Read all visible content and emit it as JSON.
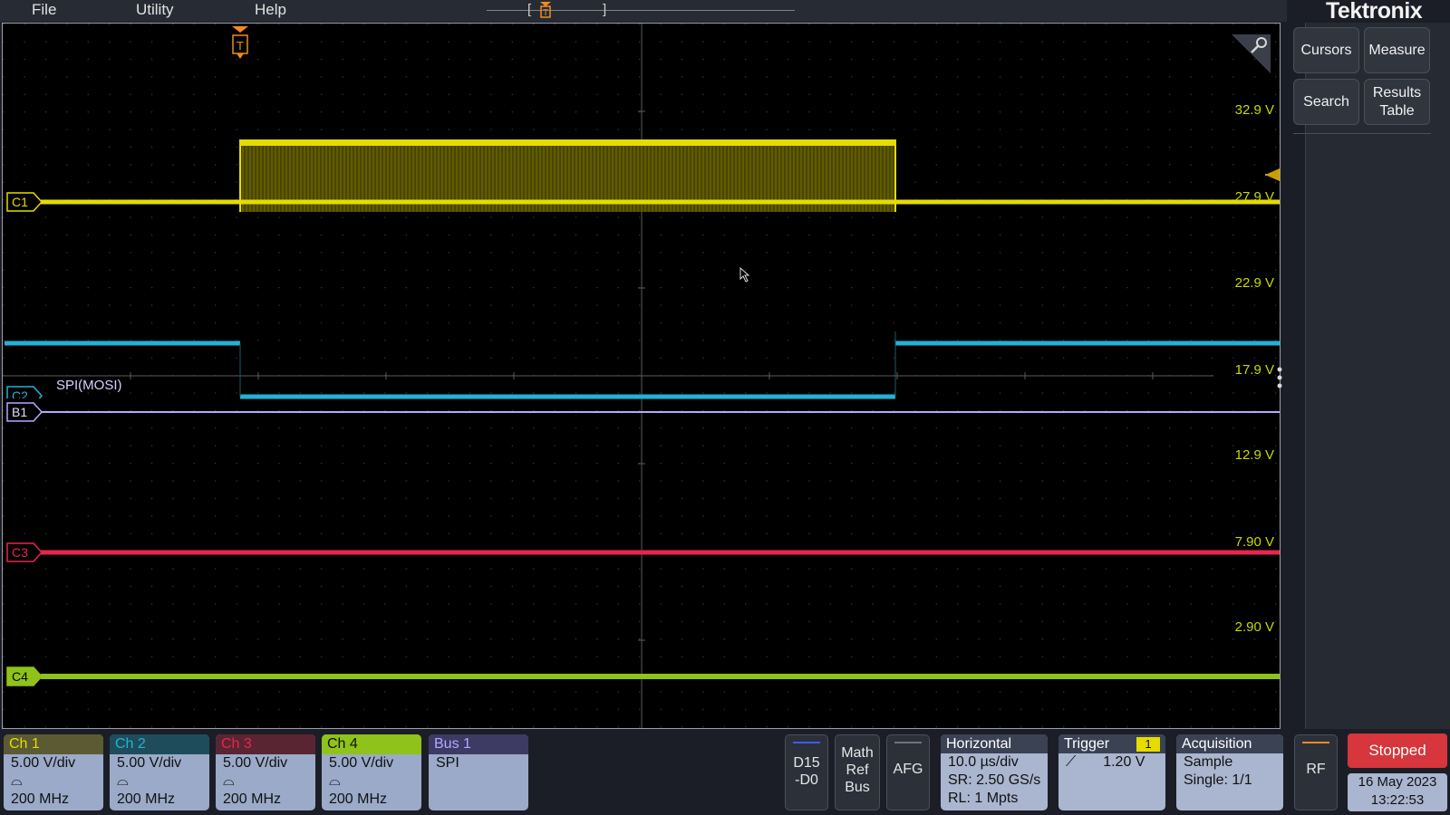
{
  "menu": {
    "file": "File",
    "utility": "Utility",
    "help": "Help"
  },
  "brand": "Tektronix",
  "trigger_marker": "T",
  "side_buttons": {
    "cursors": "Cursors",
    "measure": "Measure",
    "search": "Search",
    "results_table": "Results Table"
  },
  "voltage_labels": [
    "32.9 V",
    "27.9 V",
    "22.9 V",
    "17.9 V",
    "12.9 V",
    "7.90 V",
    "2.90 V"
  ],
  "channel_markers": {
    "c1": "C1",
    "c2": "C2",
    "b1": "B1",
    "c3": "C3",
    "c4": "C4"
  },
  "bus_trace_label": "SPI(MOSI)",
  "channels": [
    {
      "name": "Ch 1",
      "scale": "5.00 V/div",
      "bandwidth": "200 MHz",
      "color": "#e5dc00"
    },
    {
      "name": "Ch 2",
      "scale": "5.00 V/div",
      "bandwidth": "200 MHz",
      "color": "#22b2d6"
    },
    {
      "name": "Ch 3",
      "scale": "5.00 V/div",
      "bandwidth": "200 MHz",
      "color": "#e8254f"
    },
    {
      "name": "Ch 4",
      "scale": "5.00 V/div",
      "bandwidth": "200 MHz",
      "color": "#8fc21a"
    }
  ],
  "bus": {
    "name": "Bus 1",
    "protocol": "SPI"
  },
  "digital": {
    "label": "D15 -D0"
  },
  "math_ref_bus": {
    "label": "Math Ref Bus"
  },
  "afg": {
    "label": "AFG"
  },
  "horizontal": {
    "title": "Horizontal",
    "scale": "10.0 µs/div",
    "sample_rate": "SR: 2.50 GS/s",
    "record_length": "RL: 1 Mpts"
  },
  "trigger": {
    "title": "Trigger",
    "source": "1",
    "level": "1.20 V"
  },
  "acquisition": {
    "title": "Acquisition",
    "mode": "Sample",
    "single": "Single: 1/1"
  },
  "rf": {
    "label": "RF"
  },
  "run_state": {
    "label": "Stopped"
  },
  "datetime": {
    "date": "16 May 2023",
    "time": "13:22:53"
  },
  "colors": {
    "ch1": "#e5dc00",
    "ch2": "#22b2d6",
    "ch3": "#e8254f",
    "ch4": "#8fc21a",
    "bus": "#b7a8ff",
    "trigger": "#f08c1e",
    "stopped": "#d6363c"
  }
}
